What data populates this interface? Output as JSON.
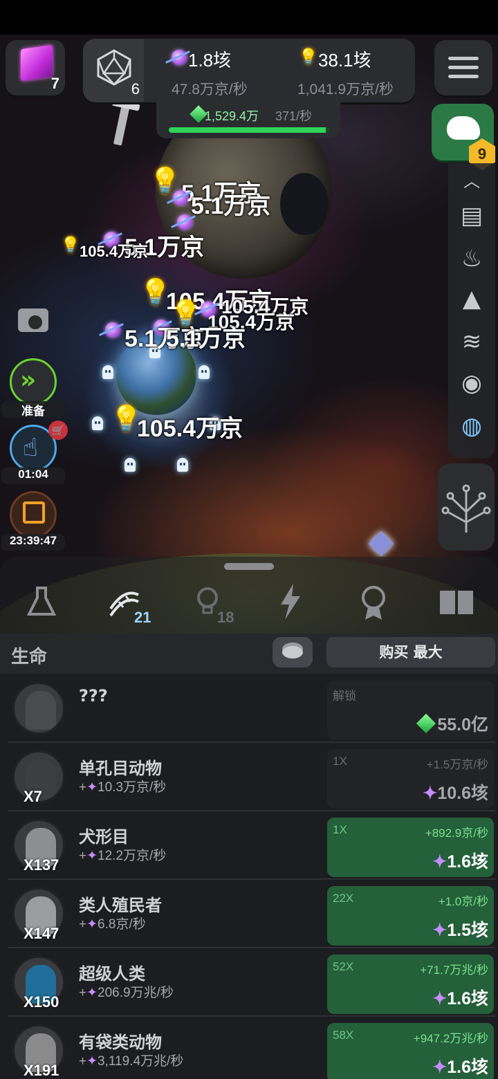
{
  "hud": {
    "cube_count": "7",
    "dice_count": "6",
    "gem_amount": "1.8垓",
    "gem_rate": "47.8万京/秒",
    "idea_amount": "38.1垓",
    "idea_rate": "1,041.9万京/秒",
    "green_amount": "1,529.4万",
    "green_rate": "371/秒",
    "green_progress": 0.98,
    "dino_badge": "9"
  },
  "floating_texts": [
    "5.1万京",
    "5.1万京",
    "5.1万京",
    "105.4万京",
    "105.4万京",
    "105.4万京",
    "105.4万京",
    "5.1万京",
    "5.1万京",
    "105.4万京"
  ],
  "side_controls": {
    "ready_label": "准备",
    "tap_timer": "01:04",
    "calendar_timer": "23:39:47"
  },
  "side_menu_icons": [
    "alien-icon",
    "book-icon",
    "fire-icon",
    "mountain-icon",
    "waves-icon",
    "cell-icon",
    "globe-icon",
    "tree-icon"
  ],
  "tabs": [
    {
      "icon": "flask-icon",
      "count": ""
    },
    {
      "icon": "dna-icon",
      "count": "21"
    },
    {
      "icon": "lightbulb-icon",
      "count": "18"
    },
    {
      "icon": "lightning-icon",
      "count": ""
    },
    {
      "icon": "medal-icon",
      "count": ""
    },
    {
      "icon": "book-icon",
      "count": ""
    }
  ],
  "list": {
    "title": "生命",
    "buy_label": "购买 最大",
    "rows": [
      {
        "name": "???",
        "rate": "",
        "count": "",
        "mult": "解锁",
        "inc": "",
        "cost": "55.0亿",
        "cost_type": "green",
        "state": "locked"
      },
      {
        "name": "单孔目动物",
        "rate": "10.3万京/秒",
        "count": "X7",
        "mult": "1X",
        "inc": "+1.5万京/秒",
        "cost": "10.6垓",
        "cost_type": "gem",
        "state": "dim"
      },
      {
        "name": "犬形目",
        "rate": "12.2万京/秒",
        "count": "X137",
        "mult": "1X",
        "inc": "+892.9京/秒",
        "cost": "1.6垓",
        "cost_type": "gem",
        "state": "green"
      },
      {
        "name": "类人殖民者",
        "rate": "6.8京/秒",
        "count": "X147",
        "mult": "22X",
        "inc": "+1.0京/秒",
        "cost": "1.5垓",
        "cost_type": "gem",
        "state": "green"
      },
      {
        "name": "超级人类",
        "rate": "206.9万兆/秒",
        "count": "X150",
        "mult": "52X",
        "inc": "+71.7万兆/秒",
        "cost": "1.6垓",
        "cost_type": "gem",
        "state": "green"
      },
      {
        "name": "有袋类动物",
        "rate": "3,119.4万兆/秒",
        "count": "X191",
        "mult": "58X",
        "inc": "+947.2万兆/秒",
        "cost": "1.6垓",
        "cost_type": "gem",
        "state": "green"
      }
    ]
  }
}
